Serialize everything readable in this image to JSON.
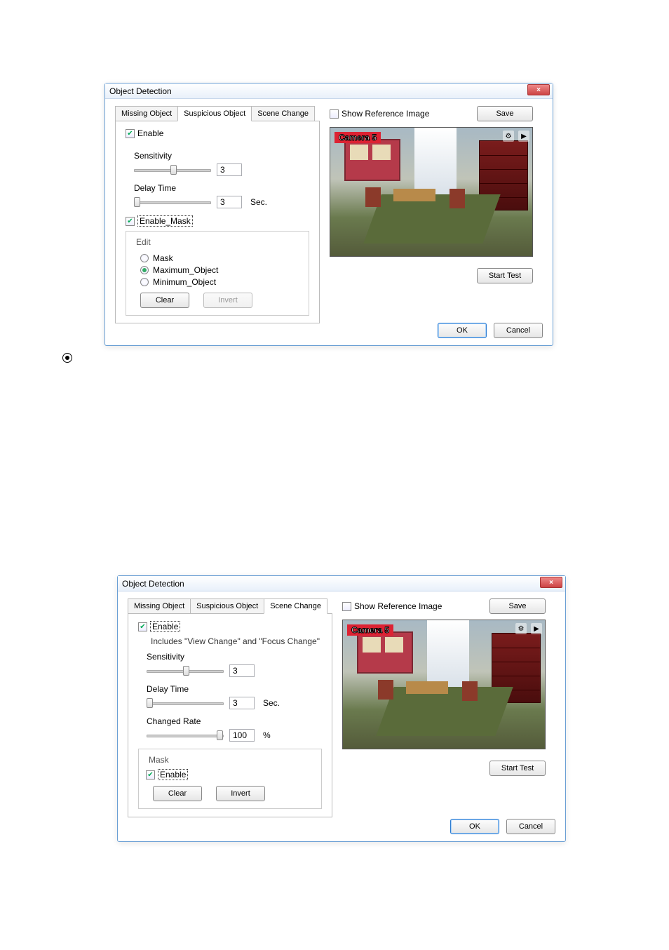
{
  "dialog1": {
    "title": "Object Detection",
    "close_label": "×",
    "tabs": {
      "missing": "Missing Object",
      "suspicious": "Suspicious Object",
      "scene": "Scene Change"
    },
    "enable_label": "Enable",
    "sensitivity_label": "Sensitivity",
    "sensitivity_value": "3",
    "delay_label": "Delay Time",
    "delay_value": "3",
    "delay_unit": "Sec.",
    "enable_mask_label": "Enable_Mask",
    "edit_legend": "Edit",
    "radios": {
      "mask": "Mask",
      "max": "Maximum_Object",
      "min": "Minimum_Object"
    },
    "clear_label": "Clear",
    "invert_label": "Invert",
    "show_ref_label": "Show Reference Image",
    "save_label": "Save",
    "camera_label": "Camera 5",
    "start_test_label": "Start Test",
    "ok_label": "OK",
    "cancel_label": "Cancel"
  },
  "dialog2": {
    "title": "Object Detection",
    "close_label": "×",
    "tabs": {
      "missing": "Missing Object",
      "suspicious": "Suspicious Object",
      "scene": "Scene Change"
    },
    "enable_label": "Enable",
    "subtext": "Includes \"View Change\" and \"Focus Change\"",
    "sensitivity_label": "Sensitivity",
    "sensitivity_value": "3",
    "delay_label": "Delay Time",
    "delay_value": "3",
    "delay_unit": "Sec.",
    "changed_rate_label": "Changed Rate",
    "changed_rate_value": "100",
    "changed_rate_unit": "%",
    "mask_legend": "Mask",
    "mask_enable_label": "Enable",
    "clear_label": "Clear",
    "invert_label": "Invert",
    "show_ref_label": "Show Reference Image",
    "save_label": "Save",
    "camera_label": "Camera 5",
    "start_test_label": "Start Test",
    "ok_label": "OK",
    "cancel_label": "Cancel"
  }
}
